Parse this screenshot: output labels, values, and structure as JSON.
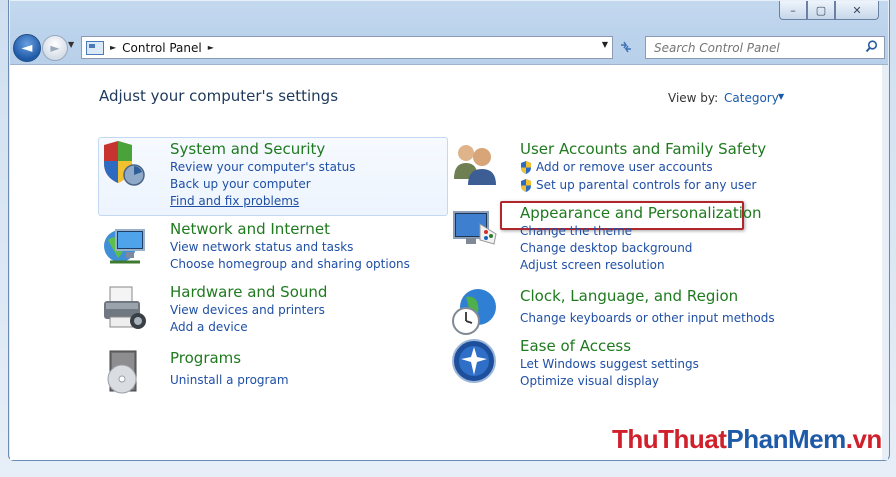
{
  "window": {
    "caption_buttons": [
      "–",
      "▢",
      "✕"
    ]
  },
  "nav": {
    "back_glyph": "◄",
    "forward_glyph": "►",
    "address": {
      "segment": "Control Panel",
      "sep": "►"
    },
    "search_placeholder": "Search Control Panel"
  },
  "main": {
    "title": "Adjust your computer's settings",
    "view_by_label": "View by:",
    "view_by_value": "Category"
  },
  "categories": [
    {
      "title": "System and Security",
      "links": [
        "Review your computer's status",
        "Back up your computer",
        "Find and fix problems"
      ]
    },
    {
      "title": "Network and Internet",
      "links": [
        "View network status and tasks",
        "Choose homegroup and sharing options"
      ]
    },
    {
      "title": "Hardware and Sound",
      "links": [
        "View devices and printers",
        "Add a device"
      ]
    },
    {
      "title": "Programs",
      "links": [
        "Uninstall a program"
      ]
    },
    {
      "title": "User Accounts and Family Safety",
      "links": [
        "Add or remove user accounts",
        "Set up parental controls for any user"
      ]
    },
    {
      "title": "Appearance and Personalization",
      "links": [
        "Change the theme",
        "Change desktop background",
        "Adjust screen resolution"
      ]
    },
    {
      "title": "Clock, Language, and Region",
      "links": [
        "Change keyboards or other input methods"
      ]
    },
    {
      "title": "Ease of Access",
      "links": [
        "Let Windows suggest settings",
        "Optimize visual display"
      ]
    }
  ],
  "watermark": {
    "part1": "ThuThuat",
    "part2": "PhanMem",
    "part3": ".vn"
  },
  "colors": {
    "category_title": "#1f7a1f",
    "link": "#1f4fa5",
    "highlight_border": "#b1262b",
    "watermark_red": "#d0202b",
    "watermark_blue": "#1f5aa8"
  }
}
